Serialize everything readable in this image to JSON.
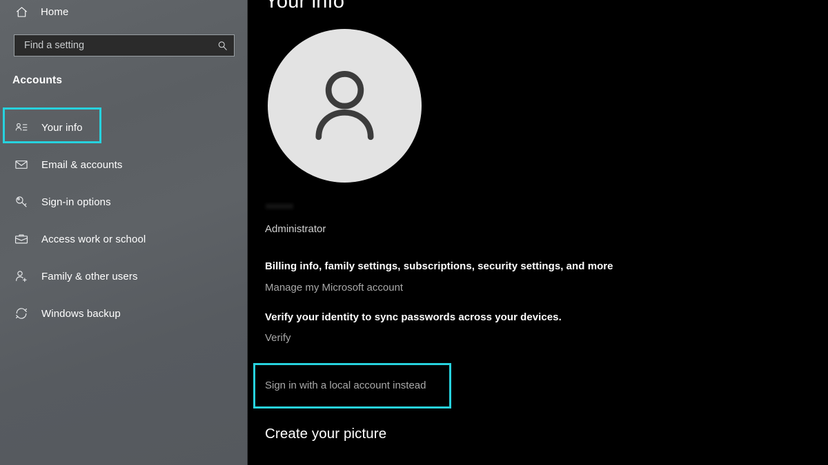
{
  "sidebar": {
    "home": {
      "label": "Home",
      "icon": "home-icon"
    },
    "search": {
      "placeholder": "Find a setting",
      "value": "",
      "icon": "search-icon"
    },
    "section_title": "Accounts",
    "items": [
      {
        "label": "Your info",
        "icon": "contact-card-icon",
        "selected": true
      },
      {
        "label": "Email & accounts",
        "icon": "envelope-icon",
        "selected": false
      },
      {
        "label": "Sign-in options",
        "icon": "key-icon",
        "selected": false
      },
      {
        "label": "Access work or school",
        "icon": "briefcase-icon",
        "selected": false
      },
      {
        "label": "Family & other users",
        "icon": "person-add-icon",
        "selected": false
      },
      {
        "label": "Windows backup",
        "icon": "sync-icon",
        "selected": false
      }
    ]
  },
  "main": {
    "page_title": "Your info",
    "avatar_icon": "person-avatar-icon",
    "account_name_redacted": "",
    "account_role": "Administrator",
    "billing_line": "Billing info, family settings, subscriptions, security settings, and more",
    "manage_account_link": "Manage my Microsoft account",
    "verify_line": "Verify your identity to sync passwords across your devices.",
    "verify_link": "Verify",
    "local_account_link": "Sign in with a local account instead",
    "create_picture_heading": "Create your picture"
  },
  "annotations": {
    "highlight_color": "#27d2de",
    "highlighted": [
      "sidebar-item-your-info",
      "sign-in-local-account-link"
    ]
  },
  "colors": {
    "sidebar_bg": "#5d6165",
    "main_bg": "#000000",
    "text_primary": "#ffffff",
    "text_secondary": "#a8a8a8",
    "avatar_bg": "#e3e3e3",
    "search_bg": "#2b2b2b",
    "search_border": "#9aa0a4"
  }
}
